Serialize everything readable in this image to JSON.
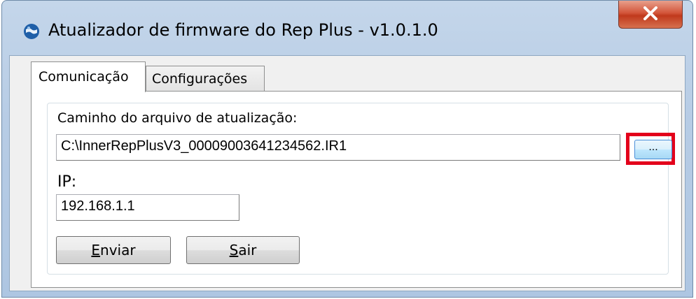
{
  "window": {
    "title": "Atualizador de firmware do Rep Plus  -  v1.0.1.0",
    "icon": "globe-app-icon",
    "close_icon": "close-icon"
  },
  "tabs": [
    {
      "label": "Comunicação",
      "active": true
    },
    {
      "label": "Configurações",
      "active": false
    }
  ],
  "form": {
    "path_label": "Caminho do arquivo de atualização:",
    "path_value": "C:\\InnerRepPlusV3_00009003641234562.IR1",
    "browse_label": "...",
    "ip_label": "IP:",
    "ip_value": "192.168.1.1"
  },
  "buttons": {
    "send": {
      "mnemonic": "E",
      "rest": "nviar"
    },
    "exit": {
      "mnemonic": "S",
      "rest": "air"
    }
  },
  "colors": {
    "highlight": "#e3001b",
    "close_button": "#c0391c",
    "titlebar": "#b7cce5"
  }
}
